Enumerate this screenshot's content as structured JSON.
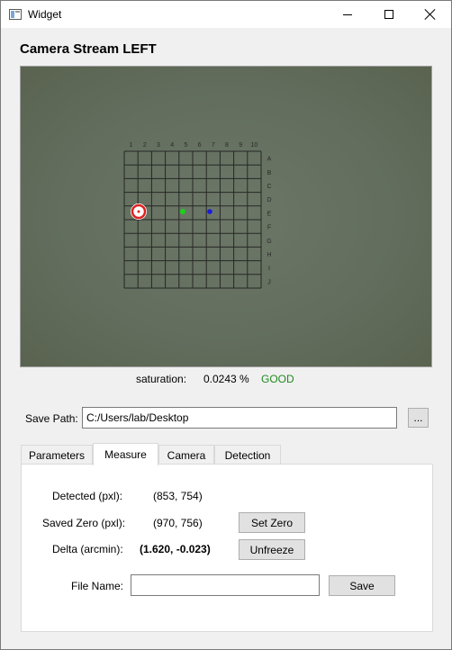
{
  "window": {
    "title": "Widget",
    "icons": {
      "app": "app-window-icon",
      "minimize": "minimize-icon",
      "maximize": "maximize-icon",
      "close": "close-icon"
    }
  },
  "heading": "Camera Stream LEFT",
  "camera": {
    "grid_column_labels": [
      "1",
      "2",
      "3",
      "4",
      "5",
      "6",
      "7",
      "8",
      "9",
      "10"
    ],
    "grid_row_labels": [
      "A",
      "B",
      "C",
      "D",
      "E",
      "F",
      "G",
      "H",
      "I",
      "J"
    ],
    "markers": {
      "target": {
        "name": "detected-target-marker",
        "color": "#e02020"
      },
      "green": {
        "name": "green-reference-dot",
        "color": "#19d419"
      },
      "blue": {
        "name": "blue-reference-dot",
        "color": "#1a1ae0"
      }
    }
  },
  "saturation": {
    "label": "saturation:",
    "value": "0.0243 %",
    "status": "GOOD",
    "status_color": "#1f8a1f"
  },
  "save_path": {
    "label": "Save Path:",
    "value": "C:/Users/lab/Desktop",
    "browse_label": "..."
  },
  "tabs": [
    {
      "label": "Parameters",
      "active": false
    },
    {
      "label": "Measure",
      "active": true
    },
    {
      "label": "Camera",
      "active": false
    },
    {
      "label": "Detection",
      "active": false
    }
  ],
  "measure": {
    "detected_label": "Detected (pxl):",
    "detected_value": "(853, 754)",
    "saved_zero_label": "Saved Zero (pxl):",
    "saved_zero_value": "(970, 756)",
    "set_zero_label": "Set Zero",
    "delta_label": "Delta (arcmin):",
    "delta_value": "(1.620, -0.023)",
    "unfreeze_label": "Unfreeze",
    "file_name_label": "File Name:",
    "file_name_value": "",
    "save_label": "Save"
  }
}
